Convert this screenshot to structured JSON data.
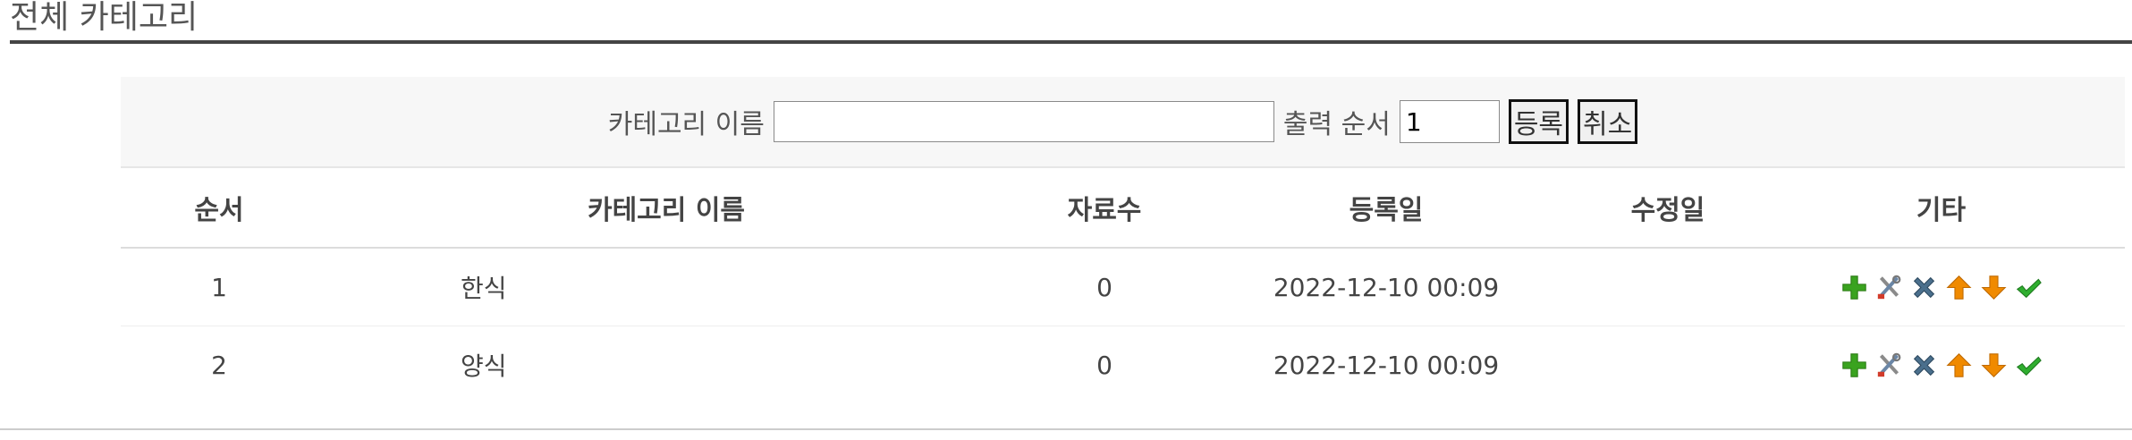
{
  "page": {
    "title": "전체 카테고리"
  },
  "form": {
    "name_label": "카테고리 이름",
    "name_value": "",
    "order_label": "출력 순서",
    "order_value": "1",
    "register_button": "등록",
    "cancel_button": "취소"
  },
  "table": {
    "headers": {
      "order": "순서",
      "name": "카테고리 이름",
      "count": "자료수",
      "registered": "등록일",
      "modified": "수정일",
      "etc": "기타"
    },
    "rows": [
      {
        "order": "1",
        "name": "한식",
        "count": "0",
        "registered": "2022-12-10 00:09",
        "modified": ""
      },
      {
        "order": "2",
        "name": "양식",
        "count": "0",
        "registered": "2022-12-10 00:09",
        "modified": ""
      }
    ],
    "row_actions": [
      "add-icon",
      "edit-tools-icon",
      "delete-icon",
      "arrow-up-icon",
      "arrow-down-icon",
      "check-icon"
    ]
  },
  "colors": {
    "add": "#3aa31f",
    "delete": "#4a6f8c",
    "arrow": "#f08a00",
    "check": "#2fae2f",
    "title_rule": "#444444"
  }
}
